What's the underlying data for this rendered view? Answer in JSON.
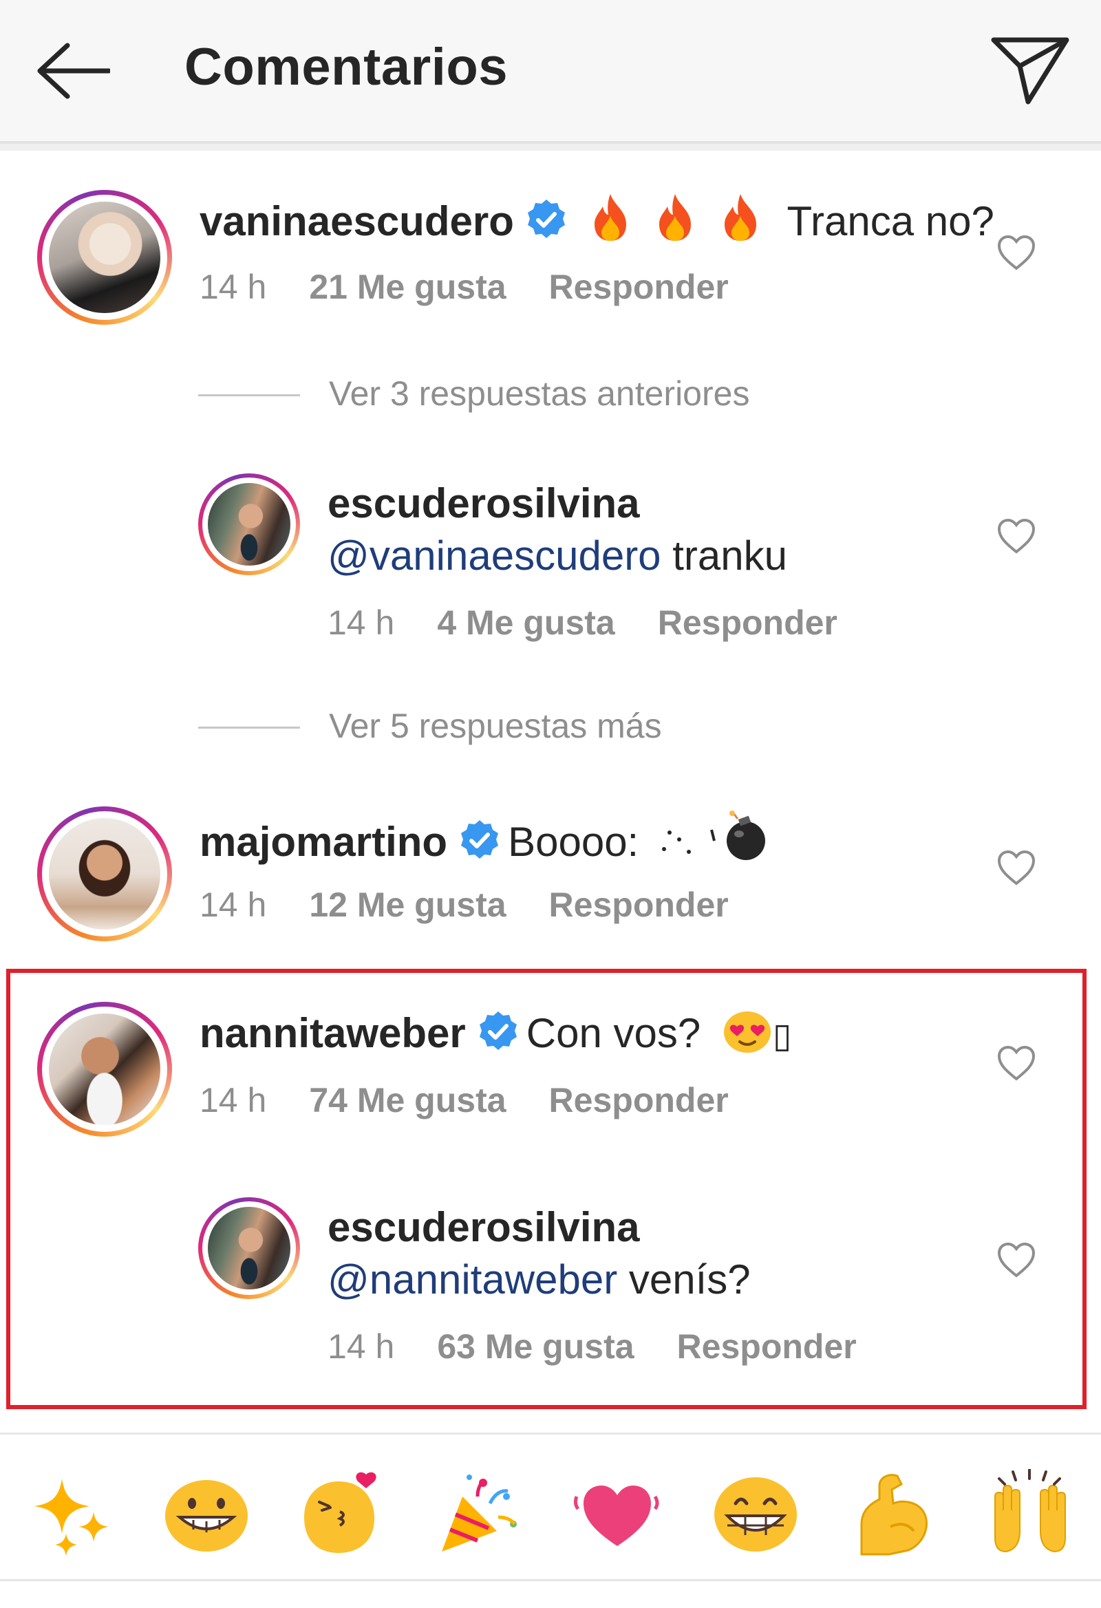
{
  "header": {
    "title": "Comentarios",
    "back_icon": "arrow-left-icon",
    "send_icon": "paper-plane-icon"
  },
  "comments": [
    {
      "username": "vaninaescudero",
      "verified": true,
      "emojis": [
        "fire-emoji",
        "fire-emoji",
        "fire-emoji"
      ],
      "text": "Tranca no?",
      "time": "14 h",
      "likes": "21 Me gusta",
      "reply": "Responder"
    },
    {
      "username": "majomartino",
      "verified": true,
      "text": "Boooo:",
      "emojis": [
        "dots-emoji",
        "bomb-emoji"
      ],
      "time": "14 h",
      "likes": "12 Me gusta",
      "reply": "Responder"
    },
    {
      "username": "nannitaweber",
      "verified": true,
      "text": "Con vos?",
      "emojis": [
        "heart-eyes-emoji",
        "missing-glyph"
      ],
      "time": "14 h",
      "likes": "74 Me gusta",
      "reply": "Responder"
    }
  ],
  "replies": [
    {
      "username": "escuderosilvina",
      "mention": "@vaninaescudero",
      "text": " tranku",
      "time": "14 h",
      "likes": "4 Me gusta",
      "reply": "Responder"
    },
    {
      "username": "escuderosilvina",
      "mention": "@nannitaweber",
      "text": " venís?",
      "time": "14 h",
      "likes": "63 Me gusta",
      "reply": "Responder"
    }
  ],
  "view_more": {
    "previous": "Ver 3 respuestas anteriores",
    "more": "Ver 5 respuestas más"
  },
  "emoji_bar": [
    "sparkles-emoji",
    "grinning-emoji",
    "kissing-emoji",
    "party-popper-emoji",
    "heart-emoji",
    "beaming-emoji",
    "flexed-biceps-emoji",
    "raising-hands-emoji"
  ],
  "glyphs": {
    "missing": "▯"
  },
  "colors": {
    "verified": "#3897f0",
    "mention": "#1f3d7a",
    "highlight": "#e0202a",
    "meta": "#8e8e8e"
  }
}
